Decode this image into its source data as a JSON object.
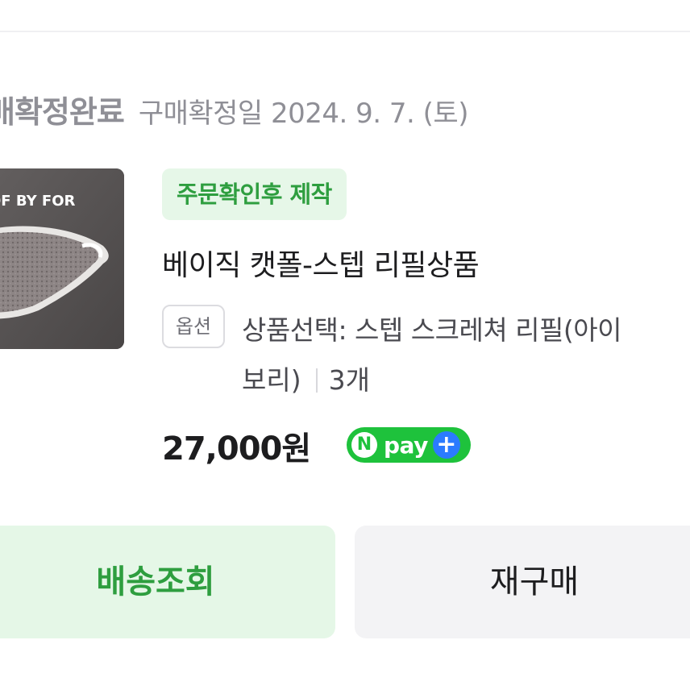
{
  "order": {
    "status_label": "매확정완료",
    "confirm_date": "구매확정일 2024. 9. 7. (토)"
  },
  "product": {
    "thumbnail_text": "OF BY FOR",
    "badge": "주문확인후 제작",
    "name": "베이직 캣폴-스텝 리필상품",
    "option_chip": "옵션",
    "option_text_line1": "상품선택: 스텝 스크레쳐 리필(아이",
    "option_text_line2": "보리)",
    "quantity": "3개",
    "price": "27,000원"
  },
  "npay": {
    "n_letter": "N",
    "label": "pay",
    "plus": "+",
    "colors": {
      "green": "#1ec23c",
      "blue": "#2b7bff"
    }
  },
  "actions": {
    "track_label": "배송조회",
    "rebuy_label": "재구매"
  },
  "colors": {
    "accent_green": "#2e9e3f",
    "badge_bg": "#e6f7e8",
    "muted_text": "#8f8f96"
  }
}
